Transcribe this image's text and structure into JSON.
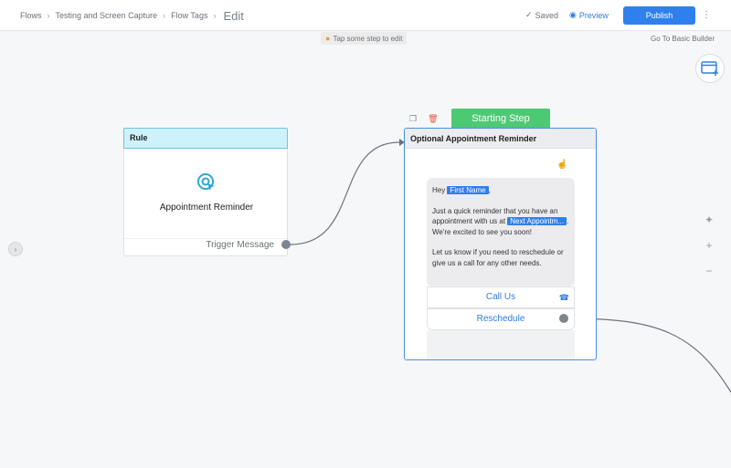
{
  "breadcrumb": {
    "items": [
      "Flows",
      "Testing and Screen Capture",
      "Flow Tags"
    ],
    "current": "Edit"
  },
  "header": {
    "saved_label": "Saved",
    "preview_label": "Preview",
    "publish_label": "Publish",
    "more_label": "⋮"
  },
  "canvas": {
    "hint_text": "Tap some step to edit",
    "basic_builder_link": "Go To Basic Builder"
  },
  "rule_card": {
    "header": "Rule",
    "title": "Appointment Reminder",
    "trigger_label": "Trigger Message"
  },
  "step_card": {
    "starting_label": "Starting Step",
    "title": "Optional Appointment Reminder",
    "message": {
      "greeting": "Hey",
      "first_name_tag": "First Name",
      "greeting_end": ",",
      "line1": "Just a quick reminder that you have an appointment with us at",
      "appointment_tag": "Next Appointm...",
      "line1_end": ".",
      "line2": "We're excited to see you soon!",
      "line3": "Let us know if you need to reschedule or give us a call for any other needs."
    },
    "buttons": [
      "Call Us",
      "Reschedule"
    ]
  },
  "side_tools": {
    "magic": "✦",
    "zoom_in": "+",
    "zoom_out": "−"
  },
  "colors": {
    "accent": "#2f80ed",
    "start_green": "#4ec973",
    "rule_header": "#cdf2fb",
    "delete_red": "#e05a3d"
  }
}
